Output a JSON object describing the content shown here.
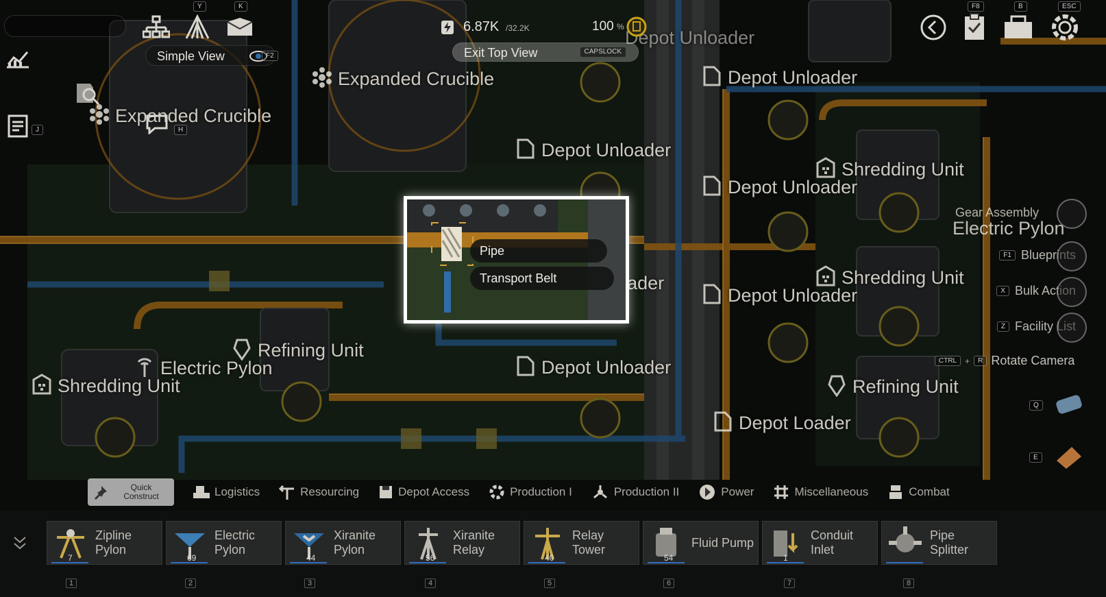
{
  "hud": {
    "power_current": "6.87K",
    "power_capacity": "/32.2K",
    "power_percent": "100",
    "percent_sign": "%",
    "exit_top_view": "Exit Top View",
    "exit_key": "CAPSLOCK",
    "simple_view": "Simple View",
    "simple_view_key": "F2",
    "key_y": "Y",
    "key_k": "K",
    "key_j": "J",
    "key_h": "H",
    "key_f8": "F8",
    "key_b": "B",
    "key_esc": "ESC"
  },
  "map_labels": [
    "Expanded Crucible",
    "Expanded Crucible",
    "Depot Unloader",
    "Depot Unloader",
    "Depot Unloader",
    "Depot Unloader",
    "Depot Unloader",
    "Depot Unloader",
    "Depot Unloader",
    "Shredding Unit",
    "Shredding Unit",
    "Shredding Unit",
    "Refining Unit",
    "Refining Unit",
    "Electric Pylon",
    "Depot Loader"
  ],
  "side_menu": {
    "gear_assembly": "Gear Assembly",
    "electric_pylon": "Electric Pylon",
    "blueprints": "Blueprints",
    "blueprints_key": "F1",
    "bulk_action": "Bulk Action",
    "bulk_key": "X",
    "facility_list": "Facility List",
    "facility_key": "Z",
    "rotate_camera": "Rotate Camera",
    "rotate_key1": "CTRL",
    "rotate_plus": "+",
    "rotate_key2": "R",
    "key_q": "Q",
    "key_e": "E"
  },
  "popup": {
    "items": [
      "Pipe",
      "Transport Belt"
    ]
  },
  "categories": {
    "quick_construct": "Quick Construct",
    "items": [
      "Logistics",
      "Resourcing",
      "Depot Access",
      "Production I",
      "Production II",
      "Power",
      "Miscellaneous",
      "Combat"
    ]
  },
  "tray": [
    {
      "name": "Zipline Pylon",
      "count": "7",
      "hotkey": "1"
    },
    {
      "name": "Electric Pylon",
      "count": "69",
      "hotkey": "2"
    },
    {
      "name": "Xiranite Pylon",
      "count": "44",
      "hotkey": "3"
    },
    {
      "name": "Xiranite Relay",
      "count": "56",
      "hotkey": "4"
    },
    {
      "name": "Relay Tower",
      "count": "40",
      "hotkey": "5"
    },
    {
      "name": "Fluid Pump",
      "count": "54",
      "hotkey": "6"
    },
    {
      "name": "Conduit Inlet",
      "count": "1",
      "hotkey": "7"
    },
    {
      "name": "Pipe Splitter",
      "count": "",
      "hotkey": "8"
    }
  ],
  "colors": {
    "conveyor": "#d98a1c",
    "pipe": "#2f6da8",
    "ground": "#1c2a1a",
    "selection": "#ffffff",
    "power_icon": "#c9a21a"
  }
}
